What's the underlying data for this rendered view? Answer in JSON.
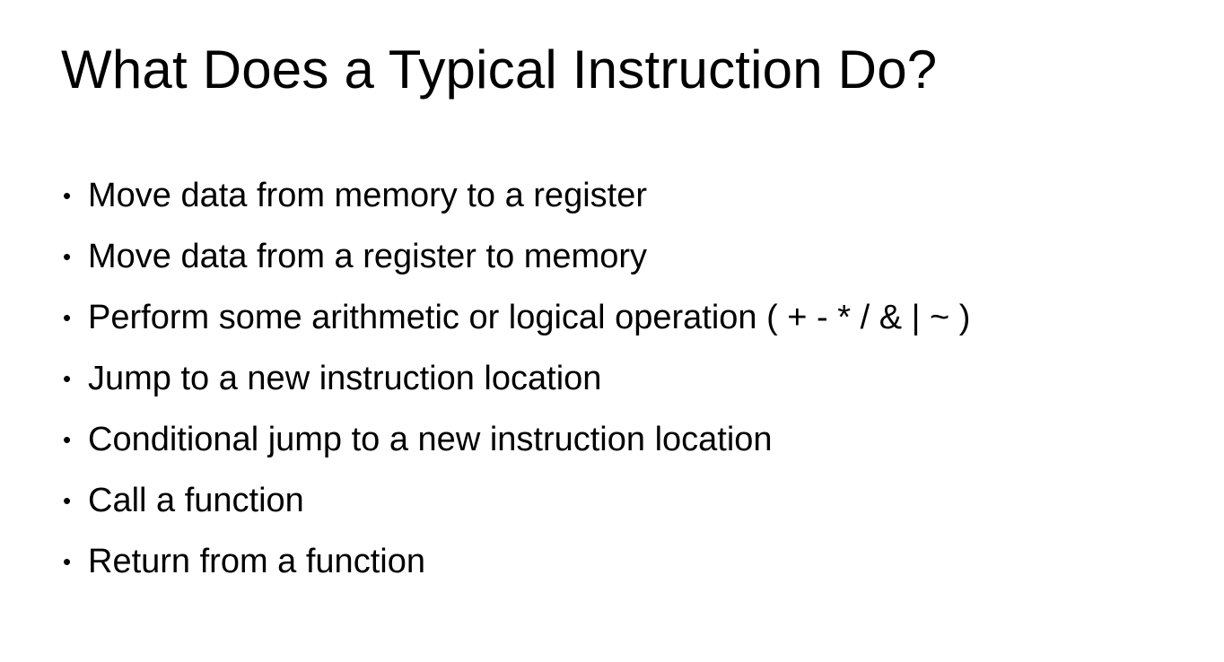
{
  "slide": {
    "title": "What Does a Typical Instruction Do?",
    "bullet_glyph": "•",
    "bullets": [
      "Move data from memory to a register",
      "Move data from a register to memory",
      "Perform some arithmetic or logical operation ( + - * / & | ~ )",
      "Jump to a new instruction location",
      "Conditional jump to a new instruction location",
      "Call a function",
      "Return from a function"
    ]
  }
}
